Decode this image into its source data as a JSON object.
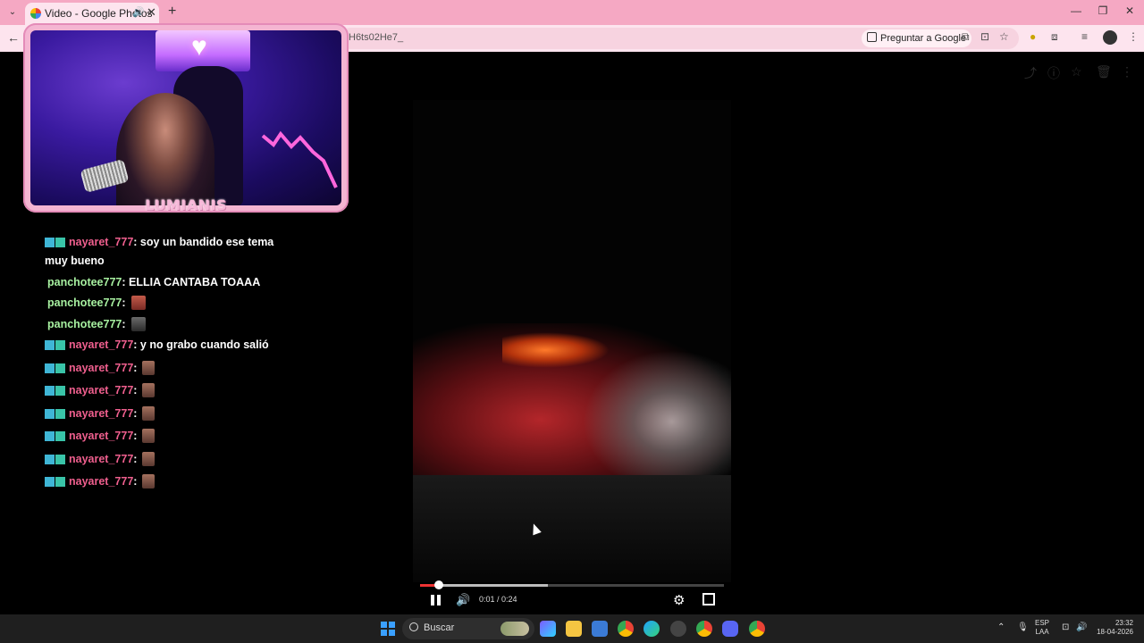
{
  "browser": {
    "tab_title": "Video - Google Photos",
    "url_fragment": "H6ts02He7_",
    "ask_google_label": "Preguntar a Google",
    "new_tab": "+",
    "tab_close": "✕",
    "back": "←",
    "window_minimize": "—",
    "window_restore": "❐",
    "window_close": "✕"
  },
  "webcam": {
    "overlay_label": "LUMIANIS"
  },
  "chat": {
    "messages": [
      {
        "user": "nayaret_777",
        "text": ": soy un bandido ese tema muy bueno"
      },
      {
        "user": "panchotee777",
        "text": ": ELLIA CANTABA TOAAA"
      },
      {
        "user": "panchotee777",
        "text": ":"
      },
      {
        "user": "panchotee777",
        "text": ":"
      },
      {
        "user": "nayaret_777",
        "text": ": y no grabo cuando salió"
      },
      {
        "user": "nayaret_777",
        "text": ":"
      },
      {
        "user": "nayaret_777",
        "text": ":"
      },
      {
        "user": "nayaret_777",
        "text": ":"
      },
      {
        "user": "nayaret_777",
        "text": ":"
      },
      {
        "user": "nayaret_777",
        "text": ":"
      },
      {
        "user": "nayaret_777",
        "text": ":"
      }
    ]
  },
  "player": {
    "time_display": "0:01 / 0:24",
    "progress_played_fraction": 0.06,
    "progress_buffered_fraction": 0.42
  },
  "taskbar": {
    "search_placeholder": "Buscar",
    "language_line1": "ESP",
    "language_line2": "LAA",
    "time": "23:32",
    "date": "18-04-2026"
  },
  "colors": {
    "tabstrip": "#f5a8c3",
    "toolbar": "#fde4ee",
    "username_pink": "#ef5f8e",
    "username_green": "#a7f0a0",
    "progress_red": "#e33"
  },
  "icons": [
    "tab-list-icon",
    "photos-favicon",
    "audio-icon",
    "lens-icon",
    "translate-icon",
    "install-icon",
    "star-icon",
    "extension-icon",
    "puzzle-icon",
    "media-icon",
    "profile-avatar",
    "menu-icon",
    "share-icon",
    "info-icon",
    "favorite-icon",
    "delete-icon",
    "more-icon",
    "pause-icon",
    "volume-icon",
    "settings-icon",
    "fullscreen-icon",
    "windows-start-icon",
    "search-icon"
  ]
}
